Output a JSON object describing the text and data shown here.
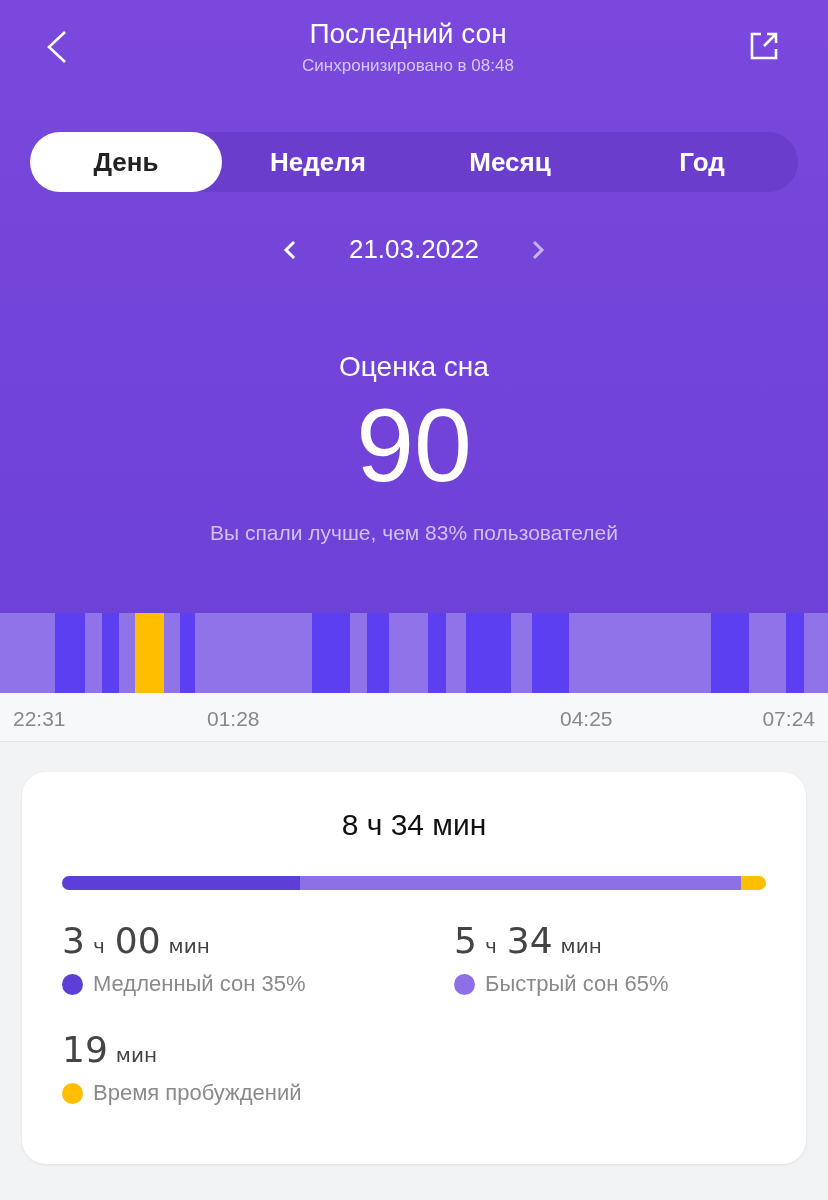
{
  "header": {
    "title": "Последний сон",
    "subtitle": "Синхронизировано в 08:48"
  },
  "tabs": [
    {
      "label": "День",
      "selected": true
    },
    {
      "label": "Неделя",
      "selected": false
    },
    {
      "label": "Месяц",
      "selected": false
    },
    {
      "label": "Год",
      "selected": false
    }
  ],
  "date": "21.03.2022",
  "score": {
    "label": "Оценка сна",
    "value": "90",
    "note": "Вы спали лучше, чем 83% пользователей"
  },
  "timeline": {
    "times": [
      "22:31",
      "01:28",
      "04:25",
      "07:24"
    ]
  },
  "summary": {
    "total": "8 ч 34 мин",
    "stats": [
      {
        "parts": [
          {
            "text": "3",
            "kind": "number"
          },
          {
            "text": "ч",
            "kind": "unit"
          },
          {
            "text": "00",
            "kind": "number"
          },
          {
            "text": "мин",
            "kind": "unit"
          }
        ],
        "label": "Медленный сон 35%",
        "color": "#5b3fd6"
      },
      {
        "parts": [
          {
            "text": "5",
            "kind": "number"
          },
          {
            "text": "ч",
            "kind": "unit"
          },
          {
            "text": "34",
            "kind": "number"
          },
          {
            "text": "мин",
            "kind": "unit"
          }
        ],
        "label": "Быстрый сон 65%",
        "color": "#8e70e6"
      },
      {
        "parts": [
          {
            "text": "19",
            "kind": "number"
          },
          {
            "text": "мин",
            "kind": "unit"
          }
        ],
        "label": "Время пробуждений",
        "color": "#ffbf00"
      }
    ]
  }
}
